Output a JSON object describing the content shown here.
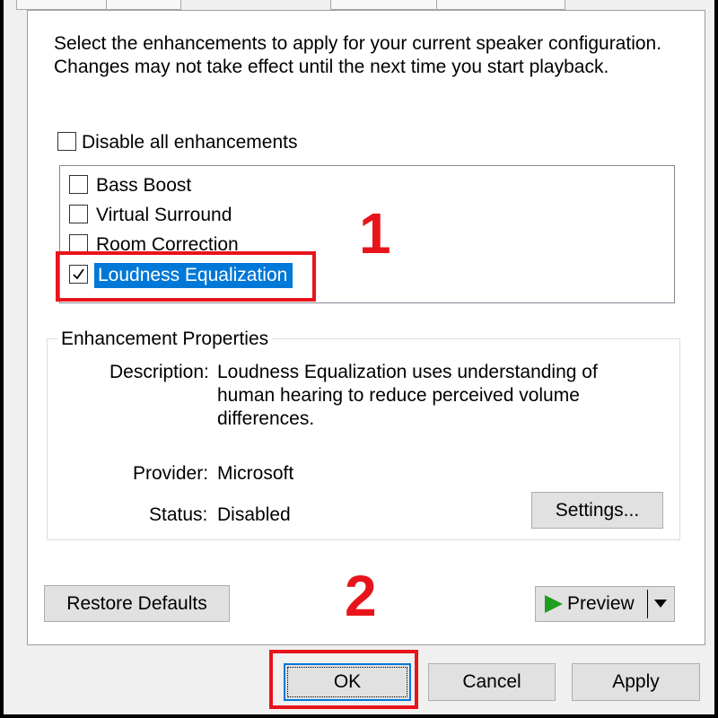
{
  "intro_text": "Select the enhancements to apply for your current speaker configuration. Changes may not take effect until the next time you start playback.",
  "disable_all": {
    "label": "Disable all enhancements",
    "checked": false
  },
  "enhancements": [
    {
      "label": "Bass Boost",
      "checked": false
    },
    {
      "label": "Virtual Surround",
      "checked": false
    },
    {
      "label": "Room Correction",
      "checked": false
    },
    {
      "label": "Loudness Equalization",
      "checked": true,
      "selected": true
    }
  ],
  "properties": {
    "group_title": "Enhancement Properties",
    "description_label": "Description:",
    "description_lines": [
      "Loudness Equalization uses understanding of",
      "human hearing to reduce perceived volume",
      "differences."
    ],
    "provider_label": "Provider:",
    "provider_value": "Microsoft",
    "status_label": "Status:",
    "status_value": "Disabled",
    "settings_button": "Settings..."
  },
  "restore_defaults_button": "Restore Defaults",
  "preview_button": "Preview",
  "dialog_buttons": {
    "ok": "OK",
    "cancel": "Cancel",
    "apply": "Apply"
  },
  "annotations": {
    "step1": "1",
    "step2": "2"
  },
  "colors": {
    "selection": "#0078d7",
    "annotation": "#e8141b",
    "play_icon": "#1e9e1e"
  }
}
